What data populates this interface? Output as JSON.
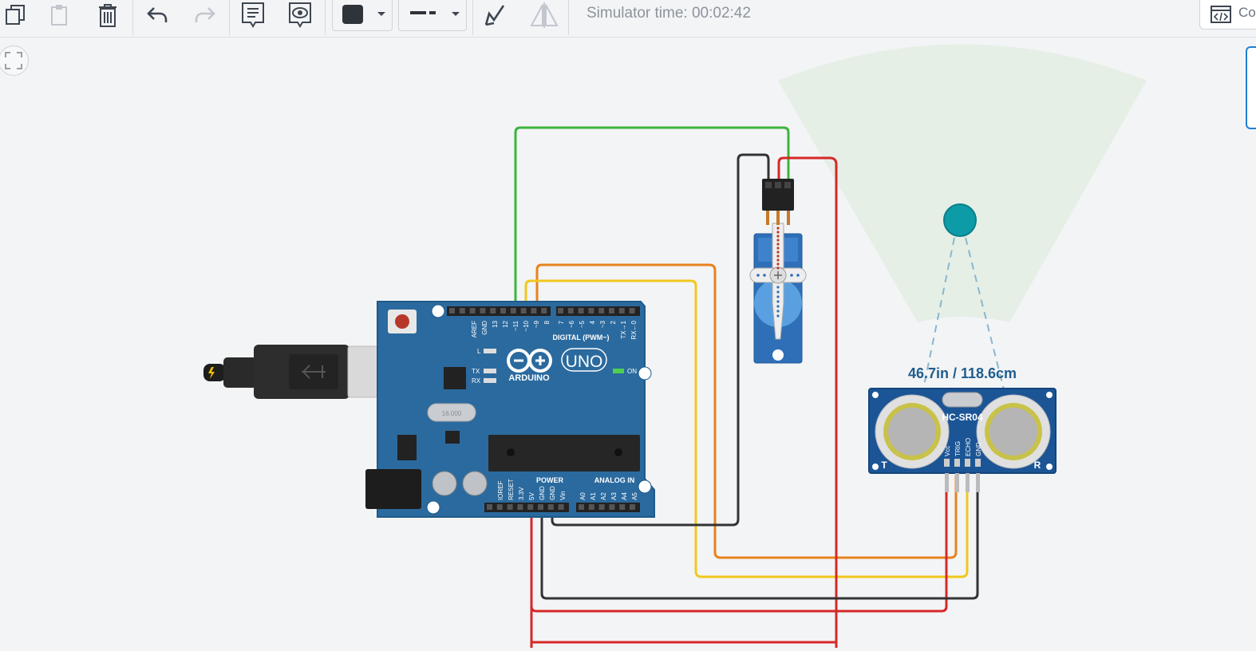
{
  "toolbar": {
    "simulator_time": "Simulator time: 00:02:42",
    "code_button_label": "Co"
  },
  "arduino": {
    "brand": "ARDUINO",
    "model": "UNO",
    "digital_label": "DIGITAL (PWM~)",
    "power_label": "POWER",
    "analog_label": "ANALOG IN",
    "on_label": "ON",
    "led_l": "L",
    "led_tx": "TX",
    "led_rx": "RX",
    "digital_pins": [
      "AREF",
      "GND",
      "13",
      "12",
      "~11",
      "~10",
      "~9",
      "8",
      "7",
      "~6",
      "~5",
      "4",
      "~3",
      "2",
      "TX→1",
      "RX←0"
    ],
    "power_pins": [
      "IOREF",
      "RESET",
      "3.3V",
      "5V",
      "GND",
      "GND",
      "Vin"
    ],
    "analog_pins": [
      "A0",
      "A1",
      "A2",
      "A3",
      "A4",
      "A5"
    ],
    "crystal_label": "16.000"
  },
  "sensor": {
    "distance_readout": "46.7in / 118.6cm",
    "model": "HC-SR04",
    "pins": [
      "Vcc",
      "TRIG",
      "ECHO",
      "GND"
    ],
    "transmit_label": "T",
    "receive_label": "R"
  },
  "colors": {
    "wire_green": "#3cb43c",
    "wire_orange": "#e8821e",
    "wire_yellow": "#f0c81e",
    "wire_red": "#d62828",
    "wire_black": "#333333",
    "board_blue": "#2b6a9e",
    "sensor_blue": "#1c5596",
    "target_teal": "#0e9ba8"
  }
}
